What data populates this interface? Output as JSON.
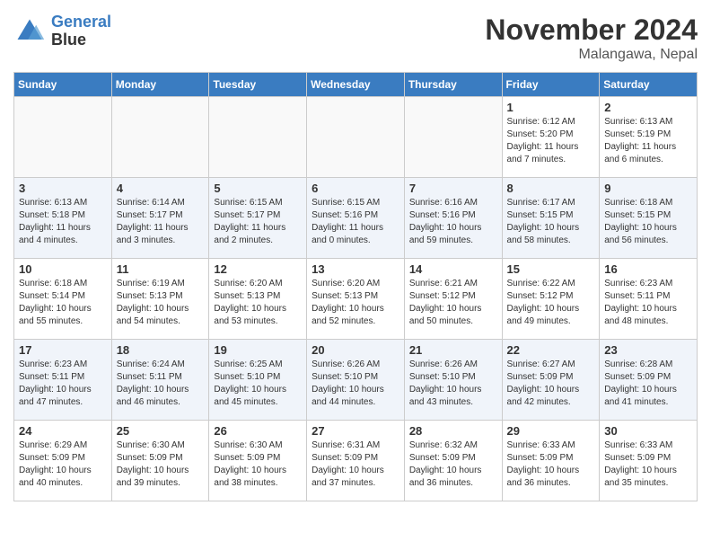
{
  "header": {
    "logo_line1": "General",
    "logo_line2": "Blue",
    "month": "November 2024",
    "location": "Malangawa, Nepal"
  },
  "days_of_week": [
    "Sunday",
    "Monday",
    "Tuesday",
    "Wednesday",
    "Thursday",
    "Friday",
    "Saturday"
  ],
  "weeks": [
    [
      {
        "day": "",
        "info": ""
      },
      {
        "day": "",
        "info": ""
      },
      {
        "day": "",
        "info": ""
      },
      {
        "day": "",
        "info": ""
      },
      {
        "day": "",
        "info": ""
      },
      {
        "day": "1",
        "info": "Sunrise: 6:12 AM\nSunset: 5:20 PM\nDaylight: 11 hours\nand 7 minutes."
      },
      {
        "day": "2",
        "info": "Sunrise: 6:13 AM\nSunset: 5:19 PM\nDaylight: 11 hours\nand 6 minutes."
      }
    ],
    [
      {
        "day": "3",
        "info": "Sunrise: 6:13 AM\nSunset: 5:18 PM\nDaylight: 11 hours\nand 4 minutes."
      },
      {
        "day": "4",
        "info": "Sunrise: 6:14 AM\nSunset: 5:17 PM\nDaylight: 11 hours\nand 3 minutes."
      },
      {
        "day": "5",
        "info": "Sunrise: 6:15 AM\nSunset: 5:17 PM\nDaylight: 11 hours\nand 2 minutes."
      },
      {
        "day": "6",
        "info": "Sunrise: 6:15 AM\nSunset: 5:16 PM\nDaylight: 11 hours\nand 0 minutes."
      },
      {
        "day": "7",
        "info": "Sunrise: 6:16 AM\nSunset: 5:16 PM\nDaylight: 10 hours\nand 59 minutes."
      },
      {
        "day": "8",
        "info": "Sunrise: 6:17 AM\nSunset: 5:15 PM\nDaylight: 10 hours\nand 58 minutes."
      },
      {
        "day": "9",
        "info": "Sunrise: 6:18 AM\nSunset: 5:15 PM\nDaylight: 10 hours\nand 56 minutes."
      }
    ],
    [
      {
        "day": "10",
        "info": "Sunrise: 6:18 AM\nSunset: 5:14 PM\nDaylight: 10 hours\nand 55 minutes."
      },
      {
        "day": "11",
        "info": "Sunrise: 6:19 AM\nSunset: 5:13 PM\nDaylight: 10 hours\nand 54 minutes."
      },
      {
        "day": "12",
        "info": "Sunrise: 6:20 AM\nSunset: 5:13 PM\nDaylight: 10 hours\nand 53 minutes."
      },
      {
        "day": "13",
        "info": "Sunrise: 6:20 AM\nSunset: 5:13 PM\nDaylight: 10 hours\nand 52 minutes."
      },
      {
        "day": "14",
        "info": "Sunrise: 6:21 AM\nSunset: 5:12 PM\nDaylight: 10 hours\nand 50 minutes."
      },
      {
        "day": "15",
        "info": "Sunrise: 6:22 AM\nSunset: 5:12 PM\nDaylight: 10 hours\nand 49 minutes."
      },
      {
        "day": "16",
        "info": "Sunrise: 6:23 AM\nSunset: 5:11 PM\nDaylight: 10 hours\nand 48 minutes."
      }
    ],
    [
      {
        "day": "17",
        "info": "Sunrise: 6:23 AM\nSunset: 5:11 PM\nDaylight: 10 hours\nand 47 minutes."
      },
      {
        "day": "18",
        "info": "Sunrise: 6:24 AM\nSunset: 5:11 PM\nDaylight: 10 hours\nand 46 minutes."
      },
      {
        "day": "19",
        "info": "Sunrise: 6:25 AM\nSunset: 5:10 PM\nDaylight: 10 hours\nand 45 minutes."
      },
      {
        "day": "20",
        "info": "Sunrise: 6:26 AM\nSunset: 5:10 PM\nDaylight: 10 hours\nand 44 minutes."
      },
      {
        "day": "21",
        "info": "Sunrise: 6:26 AM\nSunset: 5:10 PM\nDaylight: 10 hours\nand 43 minutes."
      },
      {
        "day": "22",
        "info": "Sunrise: 6:27 AM\nSunset: 5:09 PM\nDaylight: 10 hours\nand 42 minutes."
      },
      {
        "day": "23",
        "info": "Sunrise: 6:28 AM\nSunset: 5:09 PM\nDaylight: 10 hours\nand 41 minutes."
      }
    ],
    [
      {
        "day": "24",
        "info": "Sunrise: 6:29 AM\nSunset: 5:09 PM\nDaylight: 10 hours\nand 40 minutes."
      },
      {
        "day": "25",
        "info": "Sunrise: 6:30 AM\nSunset: 5:09 PM\nDaylight: 10 hours\nand 39 minutes."
      },
      {
        "day": "26",
        "info": "Sunrise: 6:30 AM\nSunset: 5:09 PM\nDaylight: 10 hours\nand 38 minutes."
      },
      {
        "day": "27",
        "info": "Sunrise: 6:31 AM\nSunset: 5:09 PM\nDaylight: 10 hours\nand 37 minutes."
      },
      {
        "day": "28",
        "info": "Sunrise: 6:32 AM\nSunset: 5:09 PM\nDaylight: 10 hours\nand 36 minutes."
      },
      {
        "day": "29",
        "info": "Sunrise: 6:33 AM\nSunset: 5:09 PM\nDaylight: 10 hours\nand 36 minutes."
      },
      {
        "day": "30",
        "info": "Sunrise: 6:33 AM\nSunset: 5:09 PM\nDaylight: 10 hours\nand 35 minutes."
      }
    ]
  ]
}
